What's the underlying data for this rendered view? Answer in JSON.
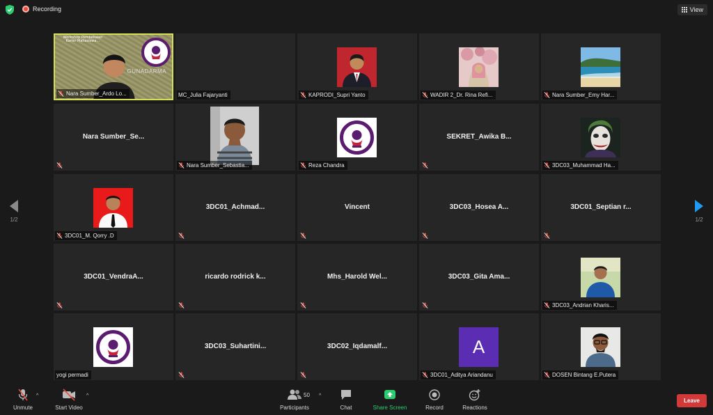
{
  "topbar": {
    "recording_label": "Recording",
    "view_label": "View"
  },
  "pagination": {
    "left_label": "1/2",
    "right_label": "1/2"
  },
  "participants": [
    {
      "display": "",
      "tag": "Nara Sumber_Ardo Lo...",
      "active": true,
      "shared_screen_text": "Workshop Pembekalan Karier Mahasiswa…",
      "shared_screen_brand": "GUNADARMA"
    },
    {
      "display": "",
      "tag": "MC_Julia Fajaryanti",
      "muted": false
    },
    {
      "display": "",
      "tag": "KAPRODI_Supri Yanto",
      "photo": "man-in-suit"
    },
    {
      "display": "",
      "tag": "WADIR 2_Dr. Rina Refi...",
      "photo": "woman-hijab-blossoms"
    },
    {
      "display": "",
      "tag": "Nara Sumber_Emy Har...",
      "photo": "beach-landscape"
    },
    {
      "display": "Nara  Sumber_Se...",
      "tag": ""
    },
    {
      "display": "",
      "tag": "Nara Sumber_Sebastia...",
      "photo": "man-selfie"
    },
    {
      "display": "",
      "tag": "Reza Chandra",
      "photo": "gunadarma-logo"
    },
    {
      "display": "SEKRET_Awika  B...",
      "tag": ""
    },
    {
      "display": "",
      "tag": "3DC03_Muhammad Ha...",
      "photo": "joker-face"
    },
    {
      "display": "",
      "tag": "3DC01_M. Qorry .D",
      "photo": "man-red-background"
    },
    {
      "display": "3DC01_Achmad...",
      "tag": ""
    },
    {
      "display": "Vincent",
      "tag": ""
    },
    {
      "display": "3DC03_Hosea  A...",
      "tag": ""
    },
    {
      "display": "3DC01_Septian  r...",
      "tag": ""
    },
    {
      "display": "3DC01_VendraA...",
      "tag": ""
    },
    {
      "display": "ricardo  rodrick  k...",
      "tag": ""
    },
    {
      "display": "Mhs_Harold  Wel...",
      "tag": ""
    },
    {
      "display": "3DC03_Gita  Ama...",
      "tag": ""
    },
    {
      "display": "",
      "tag": "3DC03_Andrian Kharis...",
      "photo": "man-outdoor-blue"
    },
    {
      "display": "",
      "tag": "yogi permadi",
      "photo": "gunadarma-logo",
      "muted": false
    },
    {
      "display": "3DC03_Suhartini...",
      "tag": ""
    },
    {
      "display": "3DC02_Iqdamalf...",
      "tag": ""
    },
    {
      "display": "",
      "tag": "3DC01_Aditya Ariandanu",
      "avatar_letter": "A"
    },
    {
      "display": "",
      "tag": "DOSEN Bintang E.Putera",
      "photo": "man-glasses"
    }
  ],
  "toolbar": {
    "unmute": "Unmute",
    "start_video": "Start Video",
    "participants": "Participants",
    "participants_count": "50",
    "chat": "Chat",
    "share_screen": "Share Screen",
    "record": "Record",
    "reactions": "Reactions",
    "leave": "Leave"
  },
  "colors": {
    "active_speaker_border": "#d4e157",
    "share_green": "#2ecc71",
    "leave_red": "#d23a3a",
    "avatar_purple": "#5b2db3",
    "muted_red": "#e74c3c"
  }
}
